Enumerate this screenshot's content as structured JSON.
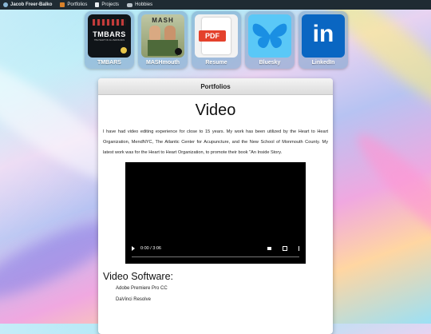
{
  "nav": {
    "brand": "Jacob Freer-Balko",
    "items": [
      {
        "label": "Portfolios",
        "icon": "folder-icon"
      },
      {
        "label": "Projects",
        "icon": "document-icon"
      },
      {
        "label": "Hobbies",
        "icon": "controller-icon"
      }
    ]
  },
  "tiles": [
    {
      "label": "TMBARS",
      "image_text": "TMBARS",
      "image_caption": "THE HEART OF ALL BAR BANDS"
    },
    {
      "label": "MASHmouth",
      "image_text": "MASH"
    },
    {
      "label": "Resume",
      "image_text": "PDF"
    },
    {
      "label": "Bluesky"
    },
    {
      "label": "LinkedIn",
      "image_text": "in"
    }
  ],
  "panel": {
    "header": "Portfolios",
    "title": "Video",
    "paragraph": "I have had video editing experience for close to 15 years. My work has been utilized by the Heart to Heart Organization, MendNYC, The Atlantic Center for Acupuncture, and the New School of Monmouth County. My latest work was for the Heart to Heart Organization, to promote their book \"An Inside Story.",
    "video": {
      "time": "0:00 / 3:06"
    },
    "software_heading": "Video Software:",
    "software": [
      "Adobe Premiere Pro CC",
      "DaVinci Resolve"
    ]
  },
  "colors": {
    "navbar": "#1f2b33",
    "video_bg": "#000000",
    "bluesky": "#3fb6f5",
    "linkedin": "#0a66c2",
    "pdf_red": "#e4412c"
  }
}
